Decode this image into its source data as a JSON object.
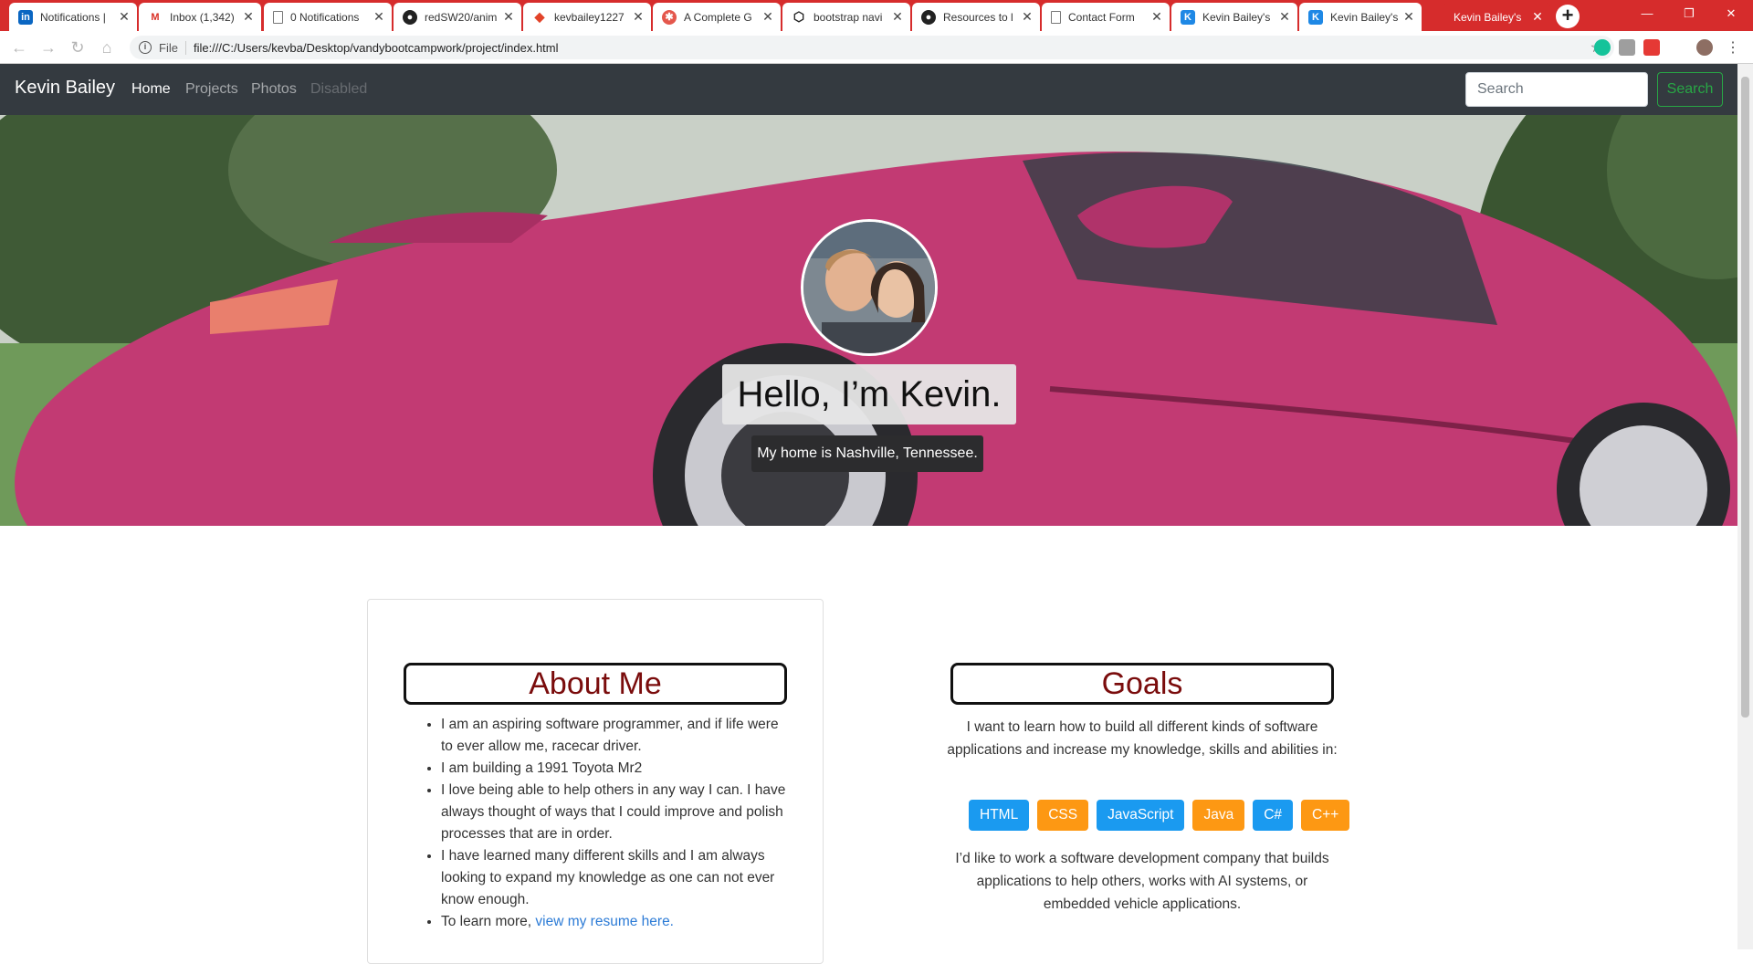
{
  "browser": {
    "tabs": [
      {
        "label": "Notifications |",
        "icon": "linkedin-icon"
      },
      {
        "label": "Inbox (1,342) -",
        "icon": "gmail-icon"
      },
      {
        "label": "0 Notifications",
        "icon": "page-icon"
      },
      {
        "label": "redSW20/anim",
        "icon": "github-icon"
      },
      {
        "label": "kevbailey1227",
        "icon": "gitlab-icon"
      },
      {
        "label": "A Complete G",
        "icon": "site-icon"
      },
      {
        "label": "bootstrap navi",
        "icon": "codepen-icon"
      },
      {
        "label": "Resources to l",
        "icon": "github-icon"
      },
      {
        "label": "Contact Form",
        "icon": "page-icon"
      },
      {
        "label": "Kevin Bailey's",
        "icon": "k-icon"
      },
      {
        "label": "Kevin Bailey's",
        "icon": "k-icon"
      },
      {
        "label": "Kevin Bailey's",
        "icon": "none"
      }
    ],
    "url_scheme": "File",
    "url": "file:///C:/Users/kevba/Desktop/vandybootcampwork/project/index.html",
    "new_tab": "+",
    "controls": {
      "minimize": "—",
      "maximize": "❐",
      "close": "✕"
    }
  },
  "navbar": {
    "brand": "Kevin Bailey",
    "links": [
      {
        "label": "Home",
        "state": "active"
      },
      {
        "label": "Projects",
        "state": "normal"
      },
      {
        "label": "Photos",
        "state": "normal"
      },
      {
        "label": "Disabled",
        "state": "disabled"
      }
    ],
    "search_placeholder": "Search",
    "search_button": "Search"
  },
  "hero": {
    "title": "Hello, I’m Kevin.",
    "subtitle": "My home is Nashville, Tennessee."
  },
  "about": {
    "heading": "About Me",
    "items": [
      "I am an aspiring software programmer, and if life were to ever allow me, racecar driver.",
      "I am building a 1991 Toyota Mr2",
      "I love being able to help others in any way I can. I have always thought of ways that I could improve and polish processes that are in order.",
      "I have learned many different skills and I am always looking to expand my knowledge as one can not ever know enough."
    ],
    "last_item_prefix": "To learn more, ",
    "resume_link": "view my resume here."
  },
  "goals": {
    "heading": "Goals",
    "intro": "I want to learn how to build all different kinds of software applications and increase my knowledge, skills and abilities in:",
    "skills": [
      {
        "label": "HTML",
        "color": "#1a9af0"
      },
      {
        "label": "CSS",
        "color": "#fd9813"
      },
      {
        "label": "JavaScript",
        "color": "#1a9af0"
      },
      {
        "label": "Java",
        "color": "#fd9813"
      },
      {
        "label": "C#",
        "color": "#1a9af0"
      },
      {
        "label": "C++",
        "color": "#fd9813"
      }
    ],
    "outro": "I’d like to work a software development company that builds applications to help others, works with AI systems, or embedded vehicle applications."
  },
  "colors": {
    "chrome": "#d62c2c",
    "navbar": "#343a40",
    "heading": "#7a0c0c",
    "success": "#28a745",
    "link": "#2c7bd6"
  }
}
